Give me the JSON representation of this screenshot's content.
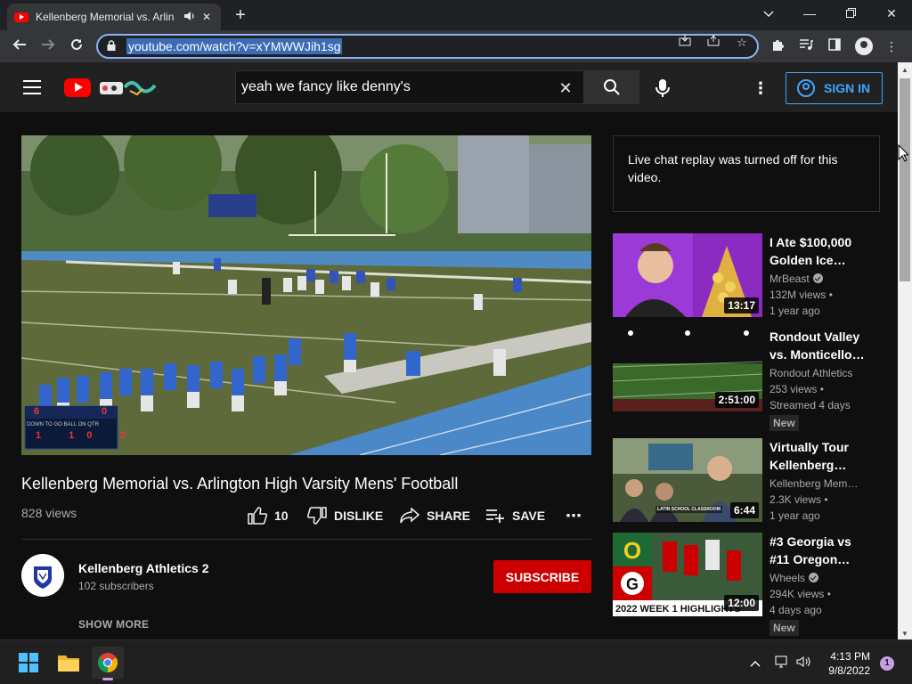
{
  "browser": {
    "tab_title": "Kellenberg Memorial vs. Arlin",
    "url": "youtube.com/watch?v=xYMWWJih1sg"
  },
  "masthead": {
    "search_query": "yeah we fancy like denny's",
    "sign_in_label": "SIGN IN"
  },
  "video": {
    "title": "Kellenberg Memorial vs. Arlington High Varsity Mens' Football",
    "views": "828 views",
    "like_count": "10",
    "dislike_label": "DISLIKE",
    "share_label": "SHARE",
    "save_label": "SAVE",
    "scoreboard": {
      "home_score": "6",
      "away_score": "0",
      "labels": "DOWN TO GO BALL ON QTR",
      "values": "1 10 2"
    }
  },
  "channel": {
    "name": "Kellenberg Athletics 2",
    "subscribers": "102 subscribers",
    "subscribe_label": "SUBSCRIBE",
    "show_more_label": "SHOW MORE"
  },
  "chat": {
    "message": "Live chat replay was turned off for this video."
  },
  "recommendations": [
    {
      "title": "I Ate $100,000 Golden Ice…",
      "channel": "MrBeast",
      "verified": true,
      "views": "132M views •",
      "age": "1 year ago",
      "duration": "13:17",
      "badge": ""
    },
    {
      "title": "Rondout Valley vs. Monticello…",
      "channel": "Rondout Athletics",
      "verified": false,
      "views": "253 views •",
      "age": "Streamed 4 days",
      "duration": "2:51:00",
      "badge": "New"
    },
    {
      "title": "Virtually Tour Kellenberg…",
      "channel": "Kellenberg Mem…",
      "verified": false,
      "views": "2.3K views •",
      "age": "1 year ago",
      "duration": "6:44",
      "badge": "",
      "thumb_caption": "LATIN SCHOOL CLASSROOM"
    },
    {
      "title": "#3 Georgia vs #11 Oregon…",
      "channel": "Wheels",
      "verified": true,
      "views": "294K views •",
      "age": "4 days ago",
      "duration": "12:00",
      "badge": "New",
      "thumb_caption": "2022 WEEK 1 HIGHLIGHTS"
    }
  ],
  "taskbar": {
    "time": "4:13 PM",
    "date": "9/8/2022",
    "notifications": "1"
  },
  "colors": {
    "accent_blue": "#3ea6ff",
    "subscribe_red": "#cc0000",
    "youtube_red": "#ff0000"
  }
}
